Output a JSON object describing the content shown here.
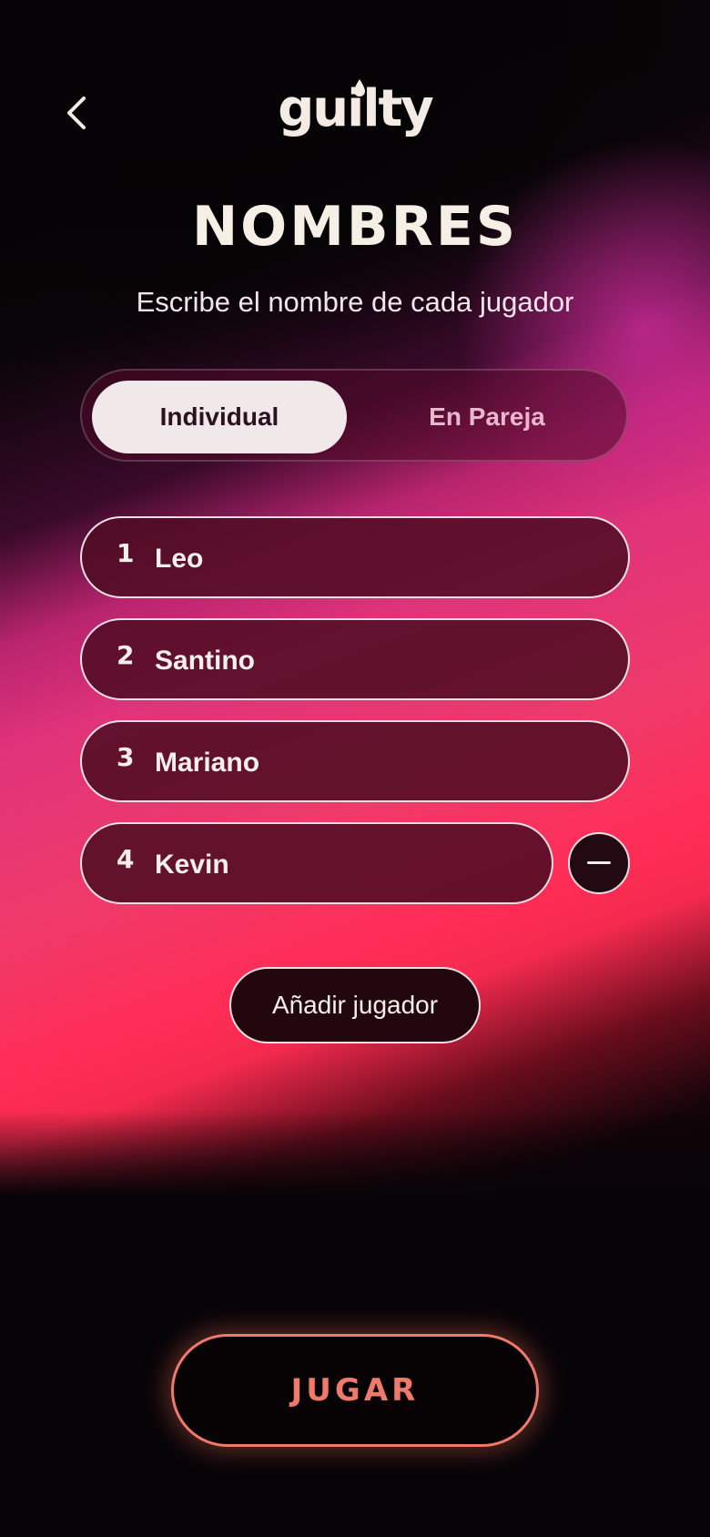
{
  "header": {
    "back_icon": "chevron-left-icon",
    "logo_text": "guilty",
    "logo_drop_icon": "drop-icon"
  },
  "page": {
    "title": "NOMBRES",
    "subtitle": "Escribe el nombre de cada jugador"
  },
  "mode_toggle": {
    "options": [
      {
        "label": "Individual",
        "selected": true
      },
      {
        "label": "En Pareja",
        "selected": false
      }
    ]
  },
  "players": [
    {
      "number": "1",
      "name": "Leo"
    },
    {
      "number": "2",
      "name": "Santino"
    },
    {
      "number": "3",
      "name": "Mariano"
    },
    {
      "number": "4",
      "name": "Kevin"
    }
  ],
  "actions": {
    "remove_icon": "minus-icon",
    "add_player_label": "Añadir jugador",
    "play_label": "JUGAR"
  },
  "colors": {
    "accent": "#f07a6a",
    "text_light": "#f6efe6",
    "toggle_active_bg": "#f1e8ea",
    "row_bg": "#500c23"
  }
}
